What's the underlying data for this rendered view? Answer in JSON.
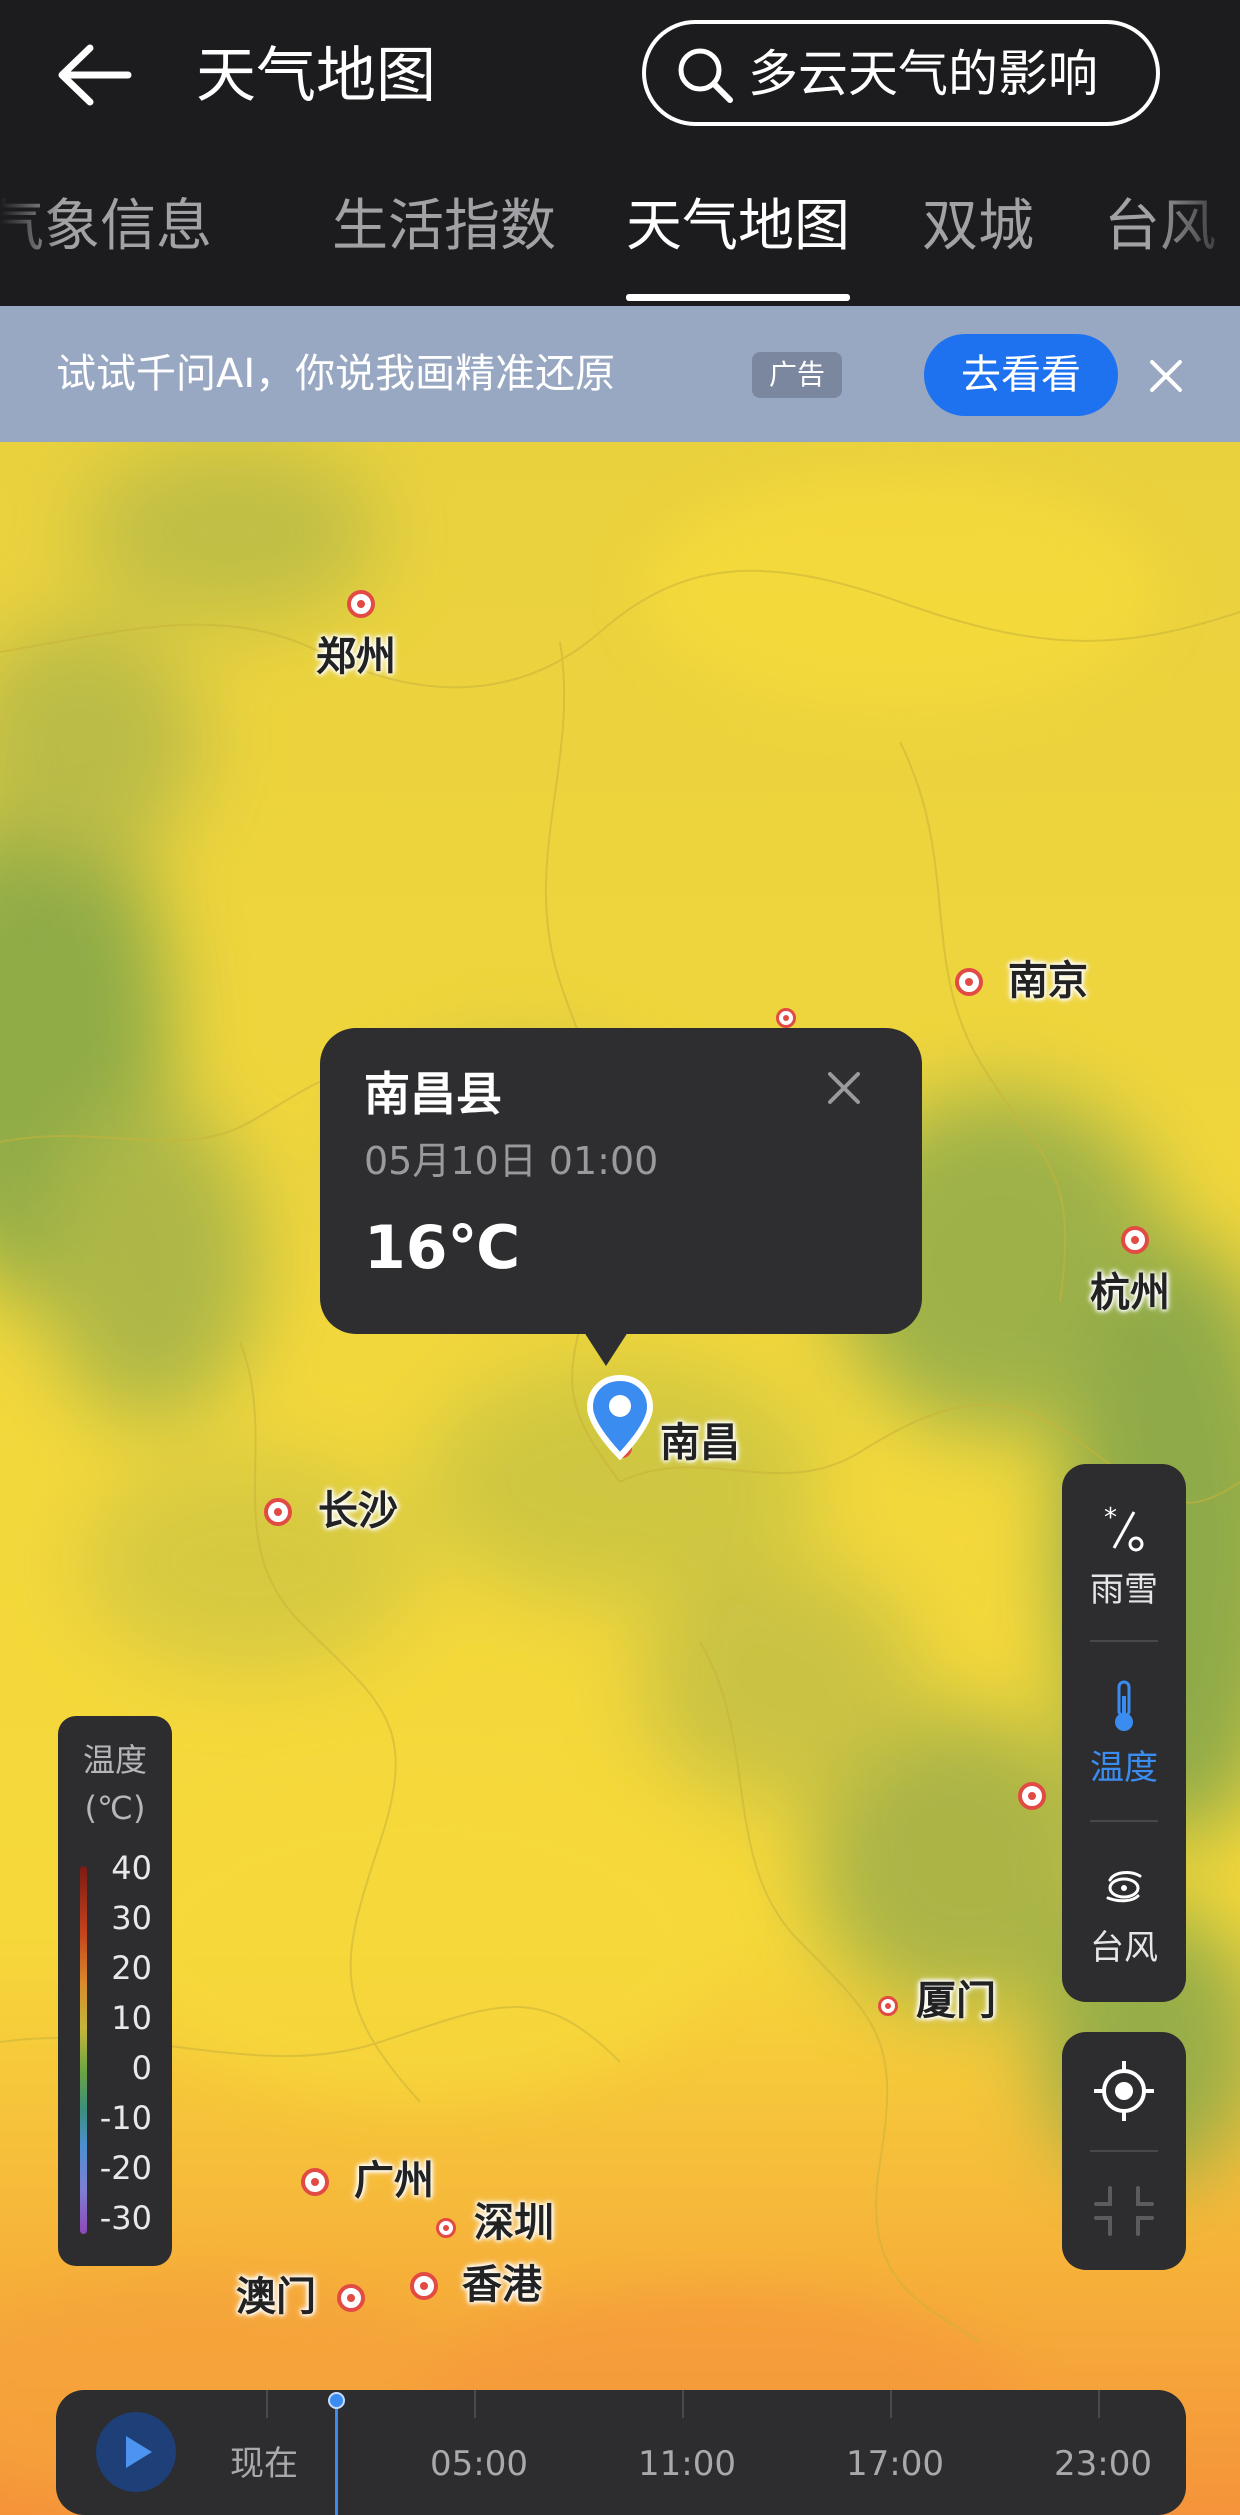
{
  "header": {
    "title": "天气地图",
    "search_text": "多云天气的影响",
    "back_icon": "arrow-left-icon"
  },
  "tabs": [
    {
      "label": "气象信息",
      "active": false
    },
    {
      "label": "生活指数",
      "active": false
    },
    {
      "label": "天气地图",
      "active": true
    },
    {
      "label": "双城",
      "active": false
    },
    {
      "label": "台风",
      "active": false
    }
  ],
  "ad": {
    "text": "试试千问AI，你说我画精准还原",
    "tag": "广告",
    "cta": "去看看",
    "close_icon": "close-icon"
  },
  "map": {
    "cities": [
      "郑州",
      "南京",
      "杭州",
      "南昌",
      "长沙",
      "厦门",
      "广州",
      "深圳",
      "澳门",
      "香港"
    ]
  },
  "popup": {
    "title": "南昌县",
    "datetime": "05月10日 01:00",
    "temperature": "16℃"
  },
  "legend": {
    "title_line1": "温度",
    "title_line2": "(℃)",
    "ticks": [
      "40",
      "30",
      "20",
      "10",
      "0",
      "-10",
      "-20",
      "-30"
    ]
  },
  "layers": [
    {
      "label": "雨雪",
      "icon": "rain-snow-icon",
      "active": false
    },
    {
      "label": "温度",
      "icon": "thermometer-icon",
      "active": true
    },
    {
      "label": "台风",
      "icon": "typhoon-icon",
      "active": false
    }
  ],
  "tools": {
    "locate_icon": "locate-icon",
    "shrink_icon": "shrink-icon"
  },
  "timeline": {
    "labels": [
      "现在",
      "05:00",
      "11:00",
      "17:00",
      "23:00"
    ],
    "play_icon": "play-icon"
  },
  "colors": {
    "accent": "#1f72ef",
    "active_layer": "#3b8cf0",
    "map_yellow": "#f2d23c",
    "map_orange": "#f2983a",
    "map_green": "#7fa54a",
    "marker_red": "#e24b44"
  }
}
